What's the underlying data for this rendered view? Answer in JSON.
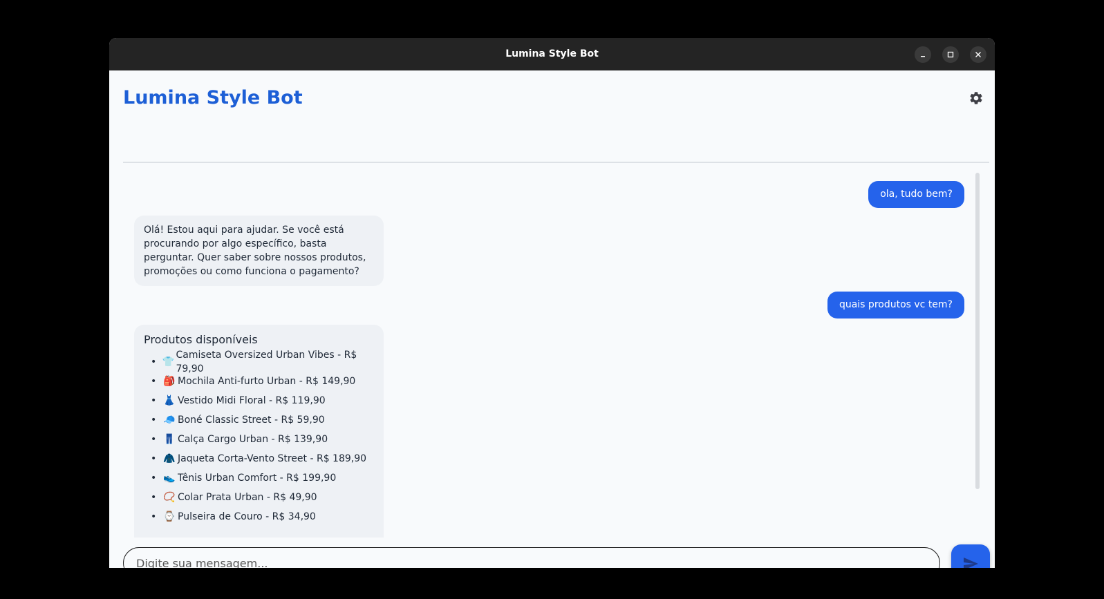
{
  "window": {
    "title": "Lumina Style Bot",
    "controls": [
      "minimize-icon",
      "maximize-icon",
      "close-icon"
    ]
  },
  "header": {
    "title": "Lumina Style Bot",
    "settings_icon": "gear-icon"
  },
  "colors": {
    "accent": "#2563eb",
    "title": "#1d5fd6",
    "titlebar": "#242424",
    "bot_bubble": "#eef1f5",
    "background": "#f8fafc"
  },
  "messages": [
    {
      "sender": "user",
      "text": "ola, tudo bem?"
    },
    {
      "sender": "bot",
      "text": "Olá! Estou aqui para ajudar. Se você está procurando por algo específico, basta perguntar. Quer saber sobre nossos produtos, promoções ou como funciona o pagamento?"
    },
    {
      "sender": "user",
      "text": "quais produtos vc tem?"
    },
    {
      "sender": "bot",
      "heading": "Produtos disponíveis",
      "items": [
        {
          "emoji": "👕",
          "text": "Camiseta Oversized Urban Vibes - R$ 79,90"
        },
        {
          "emoji": "🎒",
          "text": "Mochila Anti-furto Urban - R$ 149,90"
        },
        {
          "emoji": "👗",
          "text": "Vestido Midi Floral - R$ 119,90"
        },
        {
          "emoji": "🧢",
          "text": "Boné Classic Street - R$ 59,90"
        },
        {
          "emoji": "👖",
          "text": "Calça Cargo Urban - R$ 139,90"
        },
        {
          "emoji": "🧥",
          "text": "Jaqueta Corta-Vento Street - R$ 189,90"
        },
        {
          "emoji": "👟",
          "text": "Tênis Urban Comfort - R$ 199,90"
        },
        {
          "emoji": "📿",
          "text": "Colar Prata Urban - R$ 49,90"
        },
        {
          "emoji": "⌚",
          "text": "Pulseira de Couro - R$ 34,90"
        }
      ]
    }
  ],
  "composer": {
    "placeholder": "Digite sua mensagem...",
    "value": "",
    "send_icon": "send-icon"
  }
}
